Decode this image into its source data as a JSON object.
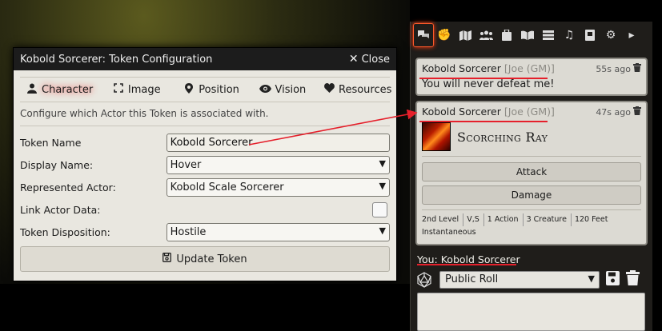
{
  "dialog": {
    "title": "Kobold Sorcerer: Token Configuration",
    "close_label": "Close",
    "tabs": [
      {
        "label": "Character",
        "icon": "user-icon"
      },
      {
        "label": "Image",
        "icon": "expand-icon"
      },
      {
        "label": "Position",
        "icon": "map-marker-icon"
      },
      {
        "label": "Vision",
        "icon": "eye-icon"
      },
      {
        "label": "Resources",
        "icon": "heart-icon"
      }
    ],
    "hint": "Configure which Actor this Token is associated with.",
    "fields": {
      "token_name_label": "Token Name",
      "token_name_value": "Kobold Sorcerer",
      "display_name_label": "Display Name:",
      "display_name_value": "Hover",
      "represented_actor_label": "Represented Actor:",
      "represented_actor_value": "Kobold Scale Sorcerer",
      "link_actor_label": "Link Actor Data:",
      "disposition_label": "Token Disposition:",
      "disposition_value": "Hostile"
    },
    "update_label": "Update Token"
  },
  "sidebar": {
    "tabs": [
      "chat-icon",
      "fist-icon",
      "map-icon",
      "users-icon",
      "suitcase-icon",
      "book-open-icon",
      "list-icon",
      "music-icon",
      "journal-icon",
      "cogs-icon",
      "chevron-right-icon"
    ],
    "messages": [
      {
        "speaker": "Kobold Sorcerer",
        "user": "[Joe (GM)]",
        "time": "55s ago",
        "text": "You will never defeat me!"
      },
      {
        "speaker": "Kobold Sorcerer",
        "user": "[Joe (GM)]",
        "time": "47s ago",
        "spell": "Scorching Ray",
        "buttons": [
          "Attack",
          "Damage"
        ],
        "props": [
          "2nd Level",
          "V,S",
          "1 Action",
          "3 Creature",
          "120 Feet",
          "Instantaneous"
        ]
      }
    ],
    "speaker_label": "You: Kobold Sorcerer",
    "roll_mode": "Public Roll"
  },
  "colors": {
    "annotation": "#e5202b",
    "dialog_bg": "#e9e7e0",
    "sidebar_bg": "#1f1d1a"
  }
}
